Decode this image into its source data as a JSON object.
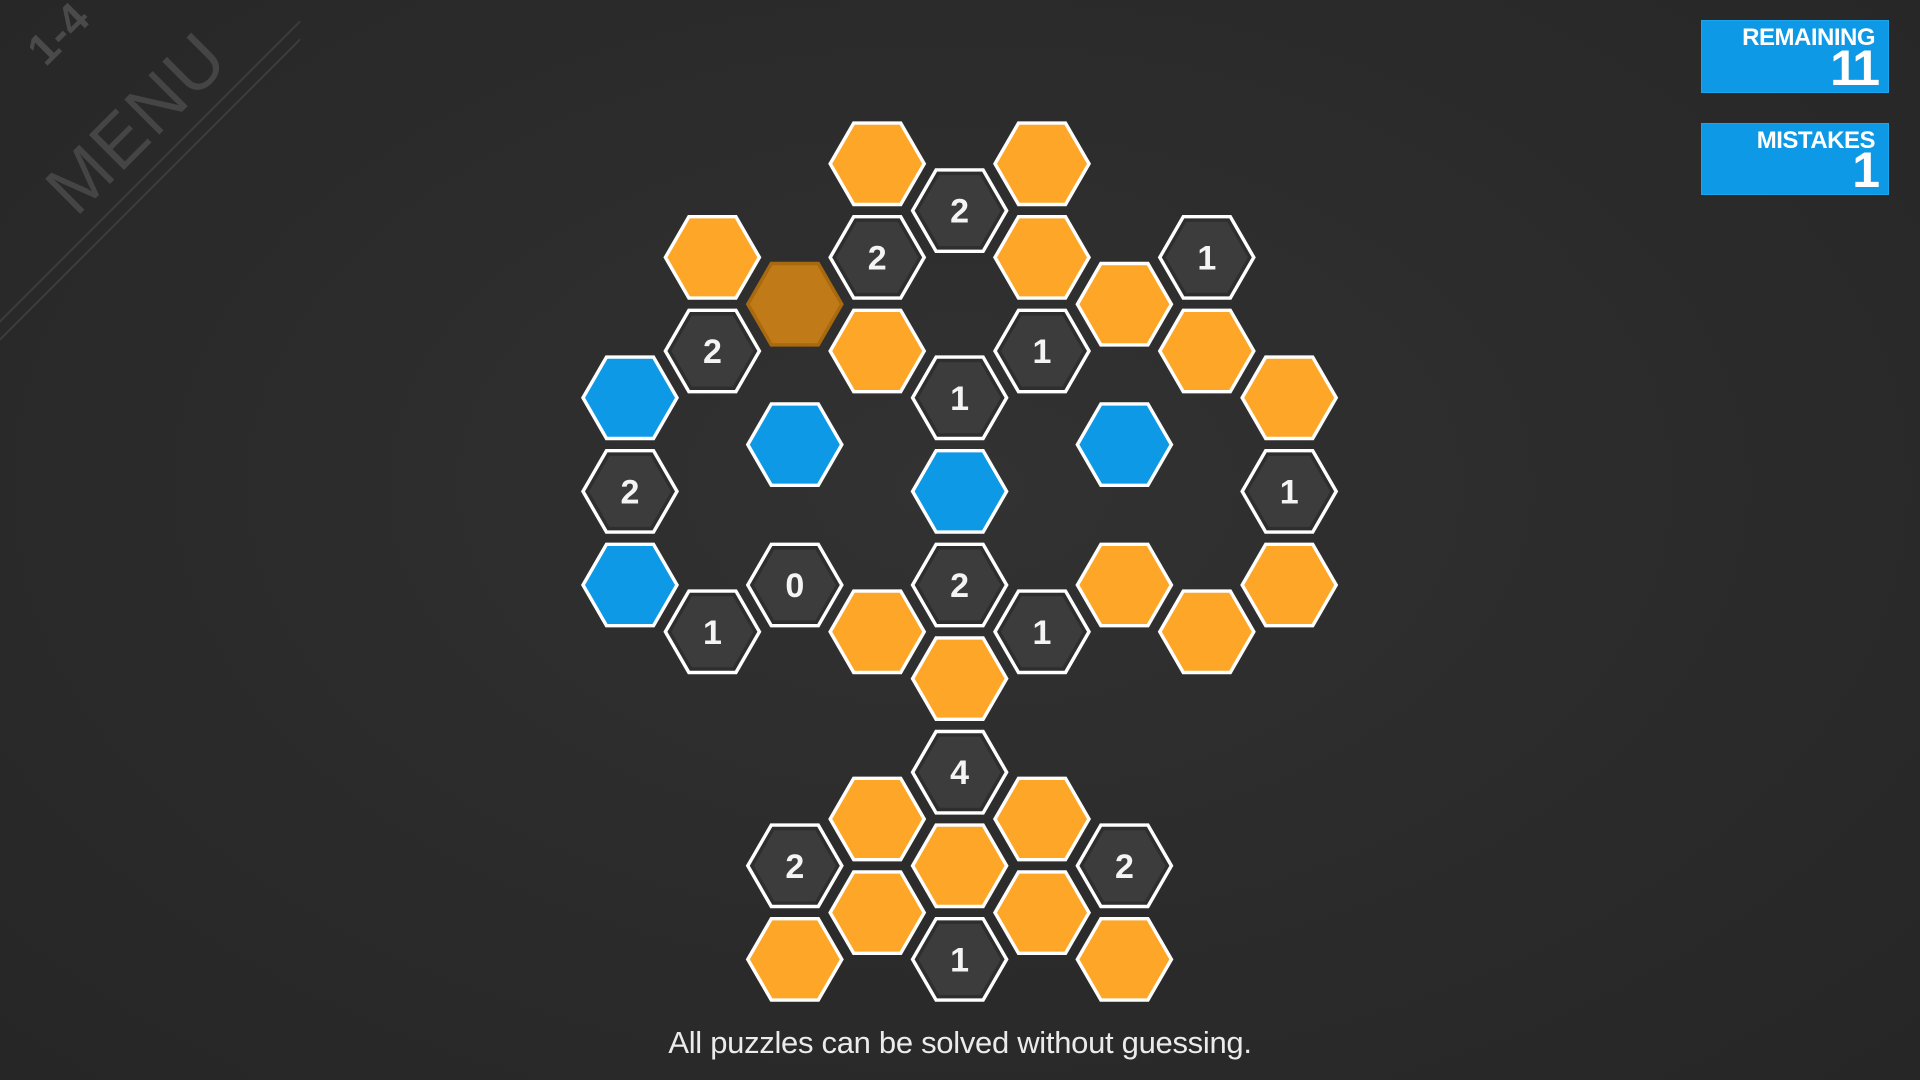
{
  "corner": {
    "level": "1-4",
    "menu_label": "MENU"
  },
  "counters": {
    "remaining_label": "REMAINING",
    "remaining_value": "11",
    "mistakes_label": "MISTAKES",
    "mistakes_value": "1"
  },
  "footer": {
    "hint": "All puzzles can be solved without guessing."
  },
  "colors": {
    "background": "#2b2b2b",
    "orange": "#fea628",
    "orange_pressed": "#c07a18",
    "blue": "#0d99e5",
    "dark_cell": "#3c3c3c",
    "outline": "#ffffff"
  },
  "grid": {
    "cells": [
      {
        "col": 0,
        "row": 6,
        "state": "blue",
        "label": ""
      },
      {
        "col": 0,
        "row": 8,
        "state": "number",
        "label": "2"
      },
      {
        "col": 0,
        "row": 10,
        "state": "blue",
        "label": ""
      },
      {
        "col": 1,
        "row": 3,
        "state": "orange",
        "label": ""
      },
      {
        "col": 1,
        "row": 5,
        "state": "number",
        "label": "2"
      },
      {
        "col": 1,
        "row": 11,
        "state": "number",
        "label": "1"
      },
      {
        "col": 2,
        "row": 4,
        "state": "orange_pressed",
        "label": ""
      },
      {
        "col": 2,
        "row": 7,
        "state": "blue",
        "label": ""
      },
      {
        "col": 2,
        "row": 10,
        "state": "number",
        "label": "0"
      },
      {
        "col": 2,
        "row": 16,
        "state": "number",
        "label": "2"
      },
      {
        "col": 2,
        "row": 18,
        "state": "orange",
        "label": ""
      },
      {
        "col": 3,
        "row": 1,
        "state": "orange",
        "label": ""
      },
      {
        "col": 3,
        "row": 3,
        "state": "number",
        "label": "2"
      },
      {
        "col": 3,
        "row": 5,
        "state": "orange",
        "label": ""
      },
      {
        "col": 3,
        "row": 11,
        "state": "orange",
        "label": ""
      },
      {
        "col": 3,
        "row": 15,
        "state": "orange",
        "label": ""
      },
      {
        "col": 3,
        "row": 17,
        "state": "orange",
        "label": ""
      },
      {
        "col": 4,
        "row": 2,
        "state": "number",
        "label": "2"
      },
      {
        "col": 4,
        "row": 6,
        "state": "number",
        "label": "1"
      },
      {
        "col": 4,
        "row": 8,
        "state": "blue",
        "label": ""
      },
      {
        "col": 4,
        "row": 10,
        "state": "number",
        "label": "2"
      },
      {
        "col": 4,
        "row": 12,
        "state": "orange",
        "label": ""
      },
      {
        "col": 4,
        "row": 14,
        "state": "number",
        "label": "4"
      },
      {
        "col": 4,
        "row": 16,
        "state": "orange",
        "label": ""
      },
      {
        "col": 4,
        "row": 18,
        "state": "number",
        "label": "1"
      },
      {
        "col": 5,
        "row": 1,
        "state": "orange",
        "label": ""
      },
      {
        "col": 5,
        "row": 3,
        "state": "orange",
        "label": ""
      },
      {
        "col": 5,
        "row": 5,
        "state": "number",
        "label": "1"
      },
      {
        "col": 5,
        "row": 11,
        "state": "number",
        "label": "1"
      },
      {
        "col": 5,
        "row": 15,
        "state": "orange",
        "label": ""
      },
      {
        "col": 5,
        "row": 17,
        "state": "orange",
        "label": ""
      },
      {
        "col": 6,
        "row": 4,
        "state": "orange",
        "label": ""
      },
      {
        "col": 6,
        "row": 7,
        "state": "blue",
        "label": ""
      },
      {
        "col": 6,
        "row": 10,
        "state": "orange",
        "label": ""
      },
      {
        "col": 6,
        "row": 16,
        "state": "number",
        "label": "2"
      },
      {
        "col": 6,
        "row": 18,
        "state": "orange",
        "label": ""
      },
      {
        "col": 7,
        "row": 3,
        "state": "number",
        "label": "1"
      },
      {
        "col": 7,
        "row": 5,
        "state": "orange",
        "label": ""
      },
      {
        "col": 7,
        "row": 11,
        "state": "orange",
        "label": ""
      },
      {
        "col": 8,
        "row": 6,
        "state": "orange",
        "label": ""
      },
      {
        "col": 8,
        "row": 8,
        "state": "number",
        "label": "1"
      },
      {
        "col": 8,
        "row": 10,
        "state": "orange",
        "label": ""
      }
    ]
  }
}
